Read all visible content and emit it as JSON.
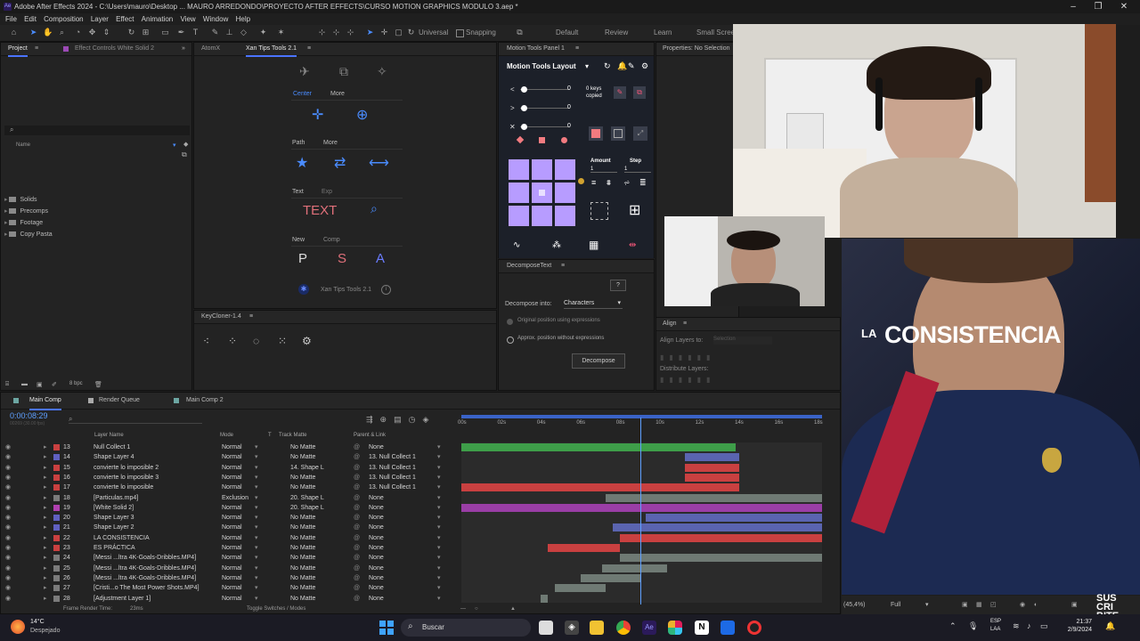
{
  "window": {
    "title": "Adobe After Effects 2024 - C:\\Users\\mauro\\Desktop ... MAURO ARREDONDO\\PROYECTO AFTER EFFECTS\\CURSO MOTION GRAPHICS MODULO 3.aep *"
  },
  "menu": [
    "File",
    "Edit",
    "Composition",
    "Layer",
    "Effect",
    "Animation",
    "View",
    "Window",
    "Help"
  ],
  "toolbar": {
    "universal": "Universal",
    "snapping": "Snapping",
    "workspaces": [
      "Default",
      "Review",
      "Learn",
      "Small Screen"
    ]
  },
  "project_panel": {
    "tab_project": "Project",
    "tab_effects": "Effect Controls White Solid 2",
    "search_placeholder": "",
    "col_name": "Name",
    "items": [
      "Solids",
      "Precomps",
      "Footage",
      "Copy Pasta"
    ],
    "bpc": "8 bpc"
  },
  "atomx_tab": "AtomX",
  "xan_panel": {
    "tab": "Xan Tips Tools 2.1",
    "center_label": "Center",
    "more1": "More",
    "path_label": "Path",
    "more2": "More",
    "text_label": "Text",
    "exp_label": "Exp",
    "text_button": "TEXT",
    "new_label": "New",
    "comp_label": "Comp",
    "p": "P",
    "s": "S",
    "a": "A",
    "footer": "Xan Tips Tools 2.1"
  },
  "keycloner": {
    "tab": "KeyCloner-1.4"
  },
  "motion_tools": {
    "tab": "Motion Tools Panel 1",
    "layout": "Motion Tools Layout",
    "sliders": [
      "0",
      "0",
      "0"
    ],
    "keys_copied": "0 keys copied",
    "amount_label": "Amount",
    "step_label": "Step",
    "amount_value": "1",
    "step_value": "1"
  },
  "decompose": {
    "tab": "DecomposeText",
    "help": "?",
    "into_label": "Decompose into:",
    "into_value": "Characters",
    "opt1": "Original position using expressions",
    "opt2": "Approx. position without expressions",
    "button": "Decompose"
  },
  "properties": {
    "tab": "Properties: No Selection"
  },
  "align": {
    "tab": "Align",
    "align_to_label": "Align Layers to:",
    "align_to_value": "Selection",
    "distribute_label": "Distribute Layers:"
  },
  "timeline": {
    "tabs": [
      "Main Comp",
      "Render Queue",
      "Main Comp 2"
    ],
    "timecode": "0:00:08:29",
    "fps_note": "00269 (30.00 fps)",
    "col_layer": "Layer Name",
    "col_mode": "Mode",
    "col_t": "T",
    "col_track": "Track Matte",
    "col_parent": "Parent & Link",
    "ruler": [
      "00s",
      "02s",
      "04s",
      "06s",
      "08s",
      "10s",
      "12s",
      "14s",
      "16s",
      "18s"
    ],
    "playhead_fraction": 0.497,
    "footer_render": "Frame Render Time:",
    "footer_ms": "23ms",
    "footer_toggle": "Toggle Switches / Modes",
    "rows": [
      {
        "num": "13",
        "name": "Null Collect 1",
        "mode": "Normal",
        "matte": "No Matte",
        "parent": "None",
        "label": "#c94040",
        "bar": {
          "start": 0.0,
          "end": 0.76,
          "color": "#3e9e49"
        }
      },
      {
        "num": "14",
        "name": "Shape Layer 4",
        "mode": "Normal",
        "matte": "No Matte",
        "parent": "13. Null Collect 1",
        "label": "#6060c0",
        "bar": {
          "start": 0.62,
          "end": 0.77,
          "color": "#5a64b0"
        }
      },
      {
        "num": "15",
        "name": "convierte lo imposible 2",
        "mode": "Normal",
        "matte": "14. Shape L",
        "parent": "13. Null Collect 1",
        "label": "#c94040",
        "bar": {
          "start": 0.62,
          "end": 0.77,
          "color": "#c94040"
        }
      },
      {
        "num": "16",
        "name": "convierte lo imposible 3",
        "mode": "Normal",
        "matte": "No Matte",
        "parent": "13. Null Collect 1",
        "label": "#c94040",
        "bar": {
          "start": 0.62,
          "end": 0.77,
          "color": "#c94040"
        }
      },
      {
        "num": "17",
        "name": "convierte lo imposible",
        "mode": "Normal",
        "matte": "No Matte",
        "parent": "13. Null Collect 1",
        "label": "#c94040",
        "bar": {
          "start": 0.0,
          "end": 0.77,
          "color": "#c94040"
        }
      },
      {
        "num": "18",
        "name": "[Particulas.mp4]",
        "mode": "Exclusion",
        "matte": "20. Shape L",
        "parent": "None",
        "label": "#7b7b7b",
        "bar": {
          "start": 0.4,
          "end": 1.0,
          "color": "#6f7a74"
        }
      },
      {
        "num": "19",
        "name": "[White Solid 2]",
        "mode": "Normal",
        "matte": "20. Shape L",
        "parent": "None",
        "label": "#b040b0",
        "bar": {
          "start": 0.0,
          "end": 1.0,
          "color": "#9a3ea6"
        }
      },
      {
        "num": "20",
        "name": "Shape Layer 3",
        "mode": "Normal",
        "matte": "No Matte",
        "parent": "None",
        "label": "#6060c0",
        "bar": {
          "start": 0.51,
          "end": 1.0,
          "color": "#5a64b0"
        }
      },
      {
        "num": "21",
        "name": "Shape Layer 2",
        "mode": "Normal",
        "matte": "No Matte",
        "parent": "None",
        "label": "#6060c0",
        "bar": {
          "start": 0.42,
          "end": 1.0,
          "color": "#5a64b0"
        }
      },
      {
        "num": "22",
        "name": "LA CONSISTENCIA",
        "mode": "Normal",
        "matte": "No Matte",
        "parent": "None",
        "label": "#c94040",
        "bar": {
          "start": 0.44,
          "end": 1.0,
          "color": "#c94040"
        }
      },
      {
        "num": "23",
        "name": "ES PRÁCTICA",
        "mode": "Normal",
        "matte": "No Matte",
        "parent": "None",
        "label": "#c94040",
        "bar": {
          "start": 0.24,
          "end": 0.44,
          "color": "#c94040"
        }
      },
      {
        "num": "24",
        "name": "[Messi ...ltra 4K-Goals-Dribbles.MP4]",
        "mode": "Normal",
        "matte": "No Matte",
        "parent": "None",
        "label": "#7b7b7b",
        "bar": {
          "start": 0.44,
          "end": 1.0,
          "color": "#6f7a74"
        }
      },
      {
        "num": "25",
        "name": "[Messi ...ltra 4K-Goals-Dribbles.MP4]",
        "mode": "Normal",
        "matte": "No Matte",
        "parent": "None",
        "label": "#7b7b7b",
        "bar": {
          "start": 0.39,
          "end": 0.57,
          "color": "#6f7a74"
        }
      },
      {
        "num": "26",
        "name": "[Messi ...ltra 4K-Goals-Dribbles.MP4]",
        "mode": "Normal",
        "matte": "No Matte",
        "parent": "None",
        "label": "#7b7b7b",
        "bar": {
          "start": 0.33,
          "end": 0.5,
          "color": "#6f7a74"
        }
      },
      {
        "num": "27",
        "name": "[Cristi...o The Most Power Shots.MP4]",
        "mode": "Normal",
        "matte": "No Matte",
        "parent": "None",
        "label": "#7b7b7b",
        "bar": {
          "start": 0.26,
          "end": 0.4,
          "color": "#6f7a74"
        }
      },
      {
        "num": "28",
        "name": "[Adjustment Layer 1]",
        "mode": "Normal",
        "matte": "No Matte",
        "parent": "None",
        "label": "#7b7b7b",
        "bar": {
          "start": 0.22,
          "end": 0.24,
          "color": "#6f7a74"
        }
      }
    ]
  },
  "preview": {
    "caption_small": "LA",
    "caption_big": "CONSISTENCIA",
    "zoom": "(45,4%)",
    "resolution": "Full"
  },
  "watermark": {
    "text": "SUS CRI BITE"
  },
  "taskbar": {
    "weather_temp": "14°C",
    "weather_desc": "Despejado",
    "search": "Buscar",
    "lang1": "ESP",
    "lang2": "LAA",
    "time": "21:37",
    "date": "2/9/2024"
  }
}
